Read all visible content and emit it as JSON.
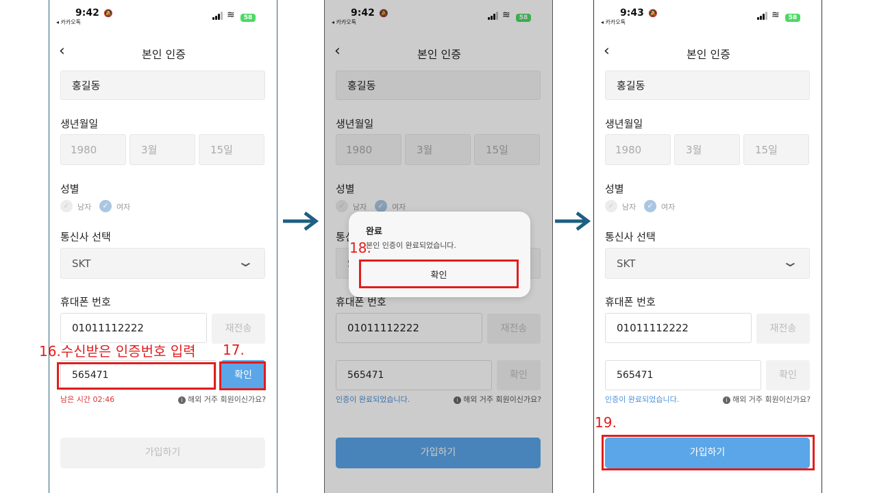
{
  "status_bar": {
    "times": [
      "9:42",
      "9:42",
      "9:43"
    ],
    "carrier": "◂ 카카오톡",
    "battery": "58"
  },
  "header": {
    "title": "본인 인증"
  },
  "form": {
    "name": "홍길동",
    "birth_label": "생년월일",
    "birth_year": "1980",
    "birth_month": "3월",
    "birth_day": "15일",
    "gender_label": "성별",
    "gender_male": "남자",
    "gender_female": "여자",
    "carrier_label": "통신사 선택",
    "carrier_value": "SKT",
    "phone_label": "휴대폰 번호",
    "phone_value": "01011112222",
    "resend_label": "재전송",
    "code_value": "565471",
    "verify_label": "확인",
    "timer_text": "남은 시간 02:46",
    "verified_text": "인증이 완료되었습니다.",
    "overseas_text": "해외 거주 회원이신가요?",
    "signup_label": "가입하기"
  },
  "dialog": {
    "title": "완료",
    "message": "본인 인증이 완료되었습니다.",
    "confirm": "확인"
  },
  "annotations": {
    "step16": "16.수신받은 인증번호 입력",
    "step17": "17.",
    "step18": "18.",
    "step19": "19."
  },
  "colors": {
    "accent": "#5aa6e8",
    "annotation_red": "#e21c1c",
    "arrow": "#1f5f82"
  }
}
